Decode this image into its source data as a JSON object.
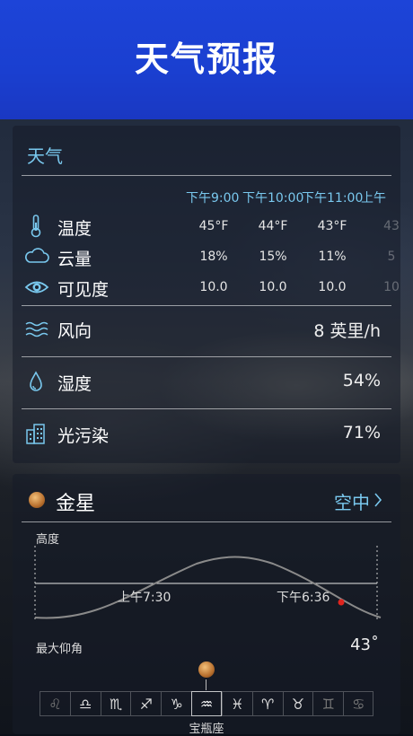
{
  "banner": {
    "title": "天气预报"
  },
  "weather": {
    "section_title": "天气",
    "times": [
      "下午9:00",
      "下午10:00",
      "下午11:00",
      "上午"
    ],
    "rows": [
      {
        "icon": "thermometer-icon",
        "label": "温度",
        "values": [
          "45°F",
          "44°F",
          "43°F",
          "43"
        ]
      },
      {
        "icon": "cloud-icon",
        "label": "云量",
        "values": [
          "18%",
          "15%",
          "11%",
          "5"
        ]
      },
      {
        "icon": "eye-icon",
        "label": "可见度",
        "values": [
          "10.0",
          "10.0",
          "10.0",
          "10"
        ]
      }
    ],
    "wind": {
      "icon": "wind-icon",
      "label": "风向",
      "value": "8 英里/h"
    },
    "humidity": {
      "icon": "water-drop-icon",
      "label": "湿度",
      "value": "54%"
    },
    "light_pollution": {
      "icon": "city-buildings-icon",
      "label": "光污染",
      "value": "71%"
    }
  },
  "planet": {
    "name": "金星",
    "icon": "venus-planet-icon",
    "sky_link": "空中",
    "altitude_label": "高度",
    "rise_time": "上午7:30",
    "set_time": "下午6:36",
    "max_elevation_label": "最大仰角",
    "max_elevation_value": "43˚",
    "zodiac": [
      "♌",
      "♎",
      "♏",
      "♐",
      "♑",
      "♒",
      "♓",
      "♈",
      "♉",
      "♊",
      "♋"
    ],
    "current_constellation": "宝瓶座"
  },
  "colors": {
    "accent": "#79c8ee",
    "banner": "#1d44d8",
    "marker": "#e0241e"
  }
}
